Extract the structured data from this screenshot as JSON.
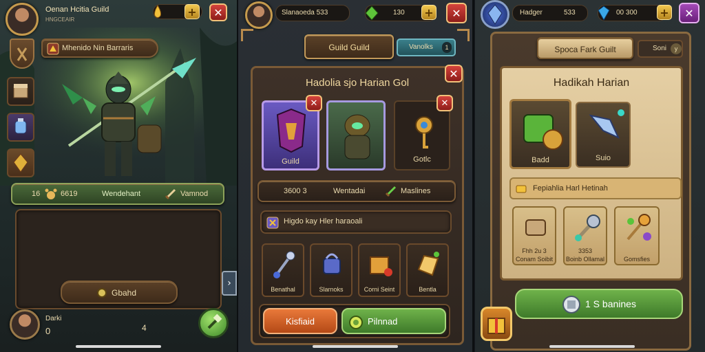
{
  "panel1": {
    "player_name": "Oenan Hcitia Guild",
    "player_sub": "HNGCEAIR",
    "currency_value": "",
    "guild_banner_label": "Mhenido Nin Barraris",
    "stats_bar": {
      "level": "16",
      "value": "6619",
      "name": "Wendehant",
      "reward": "Vamnod"
    },
    "guard_button": "Gbahd",
    "bottom_player_name": "Darki",
    "bottom_player_value": "0",
    "bottom_counter": "4"
  },
  "panel2": {
    "player_name": "Slanaoeda 533",
    "gem_value": "130",
    "tab_guild": "Guild Guild",
    "tab_vendors": "Vanolks",
    "tab_count": "1",
    "title": "Hadolia sjo Harian Gol",
    "cards": [
      {
        "label": "Guild"
      },
      {
        "label": ""
      },
      {
        "label": "Gotlc"
      }
    ],
    "info_bar": {
      "value": "3600 3",
      "name": "Wentadai",
      "tag": "Maslines"
    },
    "banner_label": "Higdo kay Hler haraoali",
    "items": [
      {
        "label": "Benathal"
      },
      {
        "label": "Slarnoks"
      },
      {
        "label": "Corni Seint"
      },
      {
        "label": "Bentla"
      }
    ],
    "btn_left": "Kisfiaid",
    "btn_right": "Pilnnad"
  },
  "panel3": {
    "player_name": "Hadger",
    "player_value": "533",
    "gem_value": "00 300",
    "tab_title": "Spoca Fark Guilt",
    "tab_side": "Soni",
    "tab_side_badge": "y",
    "title": "Hadikah Harian",
    "cards": [
      {
        "label": "Badd"
      },
      {
        "label": "Suio"
      }
    ],
    "banner_label": "Fepiahlia Harl Hetinah",
    "items": [
      {
        "label1": "Fhh 2u 3",
        "label2": "Conam Soibit"
      },
      {
        "label1": "3353",
        "label2": "Boinb Ollamal"
      },
      {
        "label1": "",
        "label2": "Gomsfies"
      }
    ],
    "main_button": "1 S banines"
  },
  "colors": {
    "gold": "#f0cf7a",
    "wood": "#5a4027",
    "close_red": "#c83a33",
    "green_btn": "#5a9a3a",
    "orange_btn": "#d2612a"
  },
  "icons": [
    "close-icon",
    "plus-icon",
    "gold-drop-icon",
    "green-gem-icon",
    "blue-gem-icon",
    "shield-icon",
    "chest-icon",
    "sword-icon",
    "scroll-icon",
    "lock-icon",
    "key-icon",
    "staff-icon",
    "chevron-right-icon",
    "hammer-icon"
  ]
}
